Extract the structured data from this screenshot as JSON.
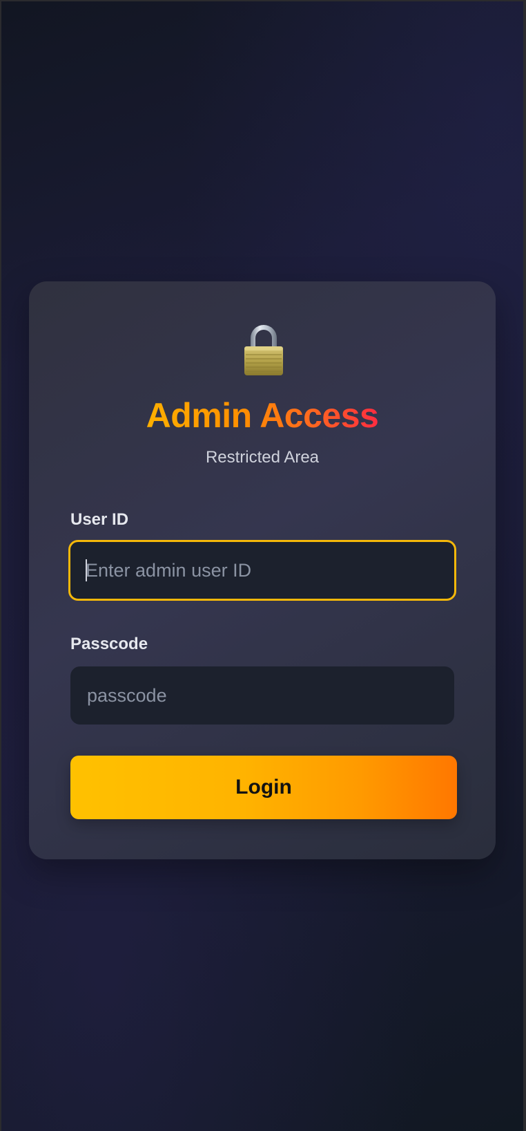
{
  "header": {
    "icon": "lock-icon",
    "title": "Admin Access",
    "subtitle": "Restricted Area"
  },
  "form": {
    "user_id": {
      "label": "User ID",
      "placeholder": "Enter admin user ID",
      "value": ""
    },
    "passcode": {
      "label": "Passcode",
      "placeholder": "passcode",
      "value": ""
    },
    "submit_label": "Login"
  },
  "colors": {
    "title_gradient": [
      "#ffb000",
      "#ff2c40"
    ],
    "focus_border": "#f5b80a",
    "button_gradient": [
      "#ffc100",
      "#ff7700"
    ],
    "card_background": "#33344a"
  }
}
